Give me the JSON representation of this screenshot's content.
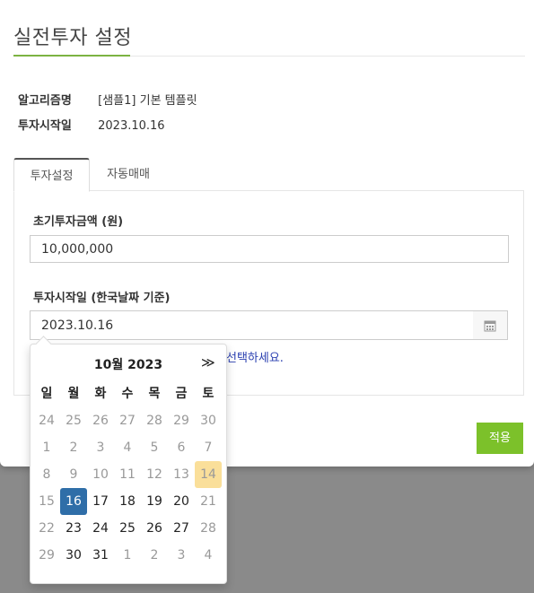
{
  "modal": {
    "title": "실전투자 설정",
    "info": [
      {
        "label": "알고리즘명",
        "value": "[샘플1] 기본 템플릿"
      },
      {
        "label": "투자시작일",
        "value": "2023.10.16"
      }
    ],
    "tabs": [
      {
        "label": "투자설정",
        "active": true
      },
      {
        "label": "자동매매",
        "active": false
      }
    ],
    "form": {
      "amount_label": "초기투자금액 (원)",
      "amount_value": "10,000,000",
      "date_label": "투자시작일 (한국날짜 기준)",
      "date_value": "2023.10.16",
      "hint": "선택하세요."
    },
    "apply_label": "적용"
  },
  "datepicker": {
    "title": "10월 2023",
    "next_glyph": "≫",
    "weekdays": [
      "일",
      "월",
      "화",
      "수",
      "목",
      "금",
      "토"
    ],
    "weeks": [
      [
        {
          "d": "24",
          "s": "muted"
        },
        {
          "d": "25",
          "s": "muted"
        },
        {
          "d": "26",
          "s": "muted"
        },
        {
          "d": "27",
          "s": "muted"
        },
        {
          "d": "28",
          "s": "muted"
        },
        {
          "d": "29",
          "s": "muted"
        },
        {
          "d": "30",
          "s": "muted"
        }
      ],
      [
        {
          "d": "1",
          "s": "muted"
        },
        {
          "d": "2",
          "s": "muted"
        },
        {
          "d": "3",
          "s": "muted"
        },
        {
          "d": "4",
          "s": "muted"
        },
        {
          "d": "5",
          "s": "muted"
        },
        {
          "d": "6",
          "s": "muted"
        },
        {
          "d": "7",
          "s": "muted"
        }
      ],
      [
        {
          "d": "8",
          "s": "muted"
        },
        {
          "d": "9",
          "s": "muted"
        },
        {
          "d": "10",
          "s": "muted"
        },
        {
          "d": "11",
          "s": "muted"
        },
        {
          "d": "12",
          "s": "muted"
        },
        {
          "d": "13",
          "s": "muted"
        },
        {
          "d": "14",
          "s": "today"
        }
      ],
      [
        {
          "d": "15",
          "s": "muted"
        },
        {
          "d": "16",
          "s": "selected"
        },
        {
          "d": "17",
          "s": ""
        },
        {
          "d": "18",
          "s": ""
        },
        {
          "d": "19",
          "s": ""
        },
        {
          "d": "20",
          "s": ""
        },
        {
          "d": "21",
          "s": "muted"
        }
      ],
      [
        {
          "d": "22",
          "s": "muted"
        },
        {
          "d": "23",
          "s": ""
        },
        {
          "d": "24",
          "s": ""
        },
        {
          "d": "25",
          "s": ""
        },
        {
          "d": "26",
          "s": ""
        },
        {
          "d": "27",
          "s": ""
        },
        {
          "d": "28",
          "s": "muted"
        }
      ],
      [
        {
          "d": "29",
          "s": "muted"
        },
        {
          "d": "30",
          "s": ""
        },
        {
          "d": "31",
          "s": ""
        },
        {
          "d": "1",
          "s": "muted"
        },
        {
          "d": "2",
          "s": "muted"
        },
        {
          "d": "3",
          "s": "muted"
        },
        {
          "d": "4",
          "s": "muted"
        }
      ]
    ]
  },
  "colors": {
    "accent": "#7cb342",
    "apply_button": "#7cc12a",
    "selected_day": "#2f6ea8",
    "today_highlight": "#fadf9a",
    "hint_text": "#2a3fb0",
    "overlay": "#8a8a8a"
  }
}
